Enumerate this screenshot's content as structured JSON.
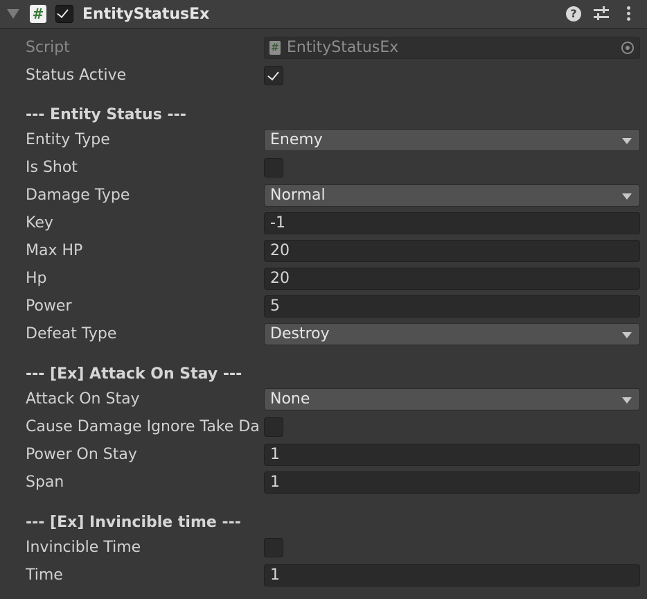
{
  "component": {
    "title": "EntityStatusEx",
    "enabled": true,
    "icon": "csharp-script-icon"
  },
  "header_icons": [
    "help-icon",
    "presets-icon",
    "kebab-menu-icon"
  ],
  "fields": {
    "script": {
      "label": "Script",
      "value": "EntityStatusEx"
    },
    "status_active": {
      "label": "Status Active",
      "checked": true
    },
    "section_entity_status": "--- Entity Status ---",
    "entity_type": {
      "label": "Entity Type",
      "value": "Enemy"
    },
    "is_shot": {
      "label": "Is Shot",
      "checked": false
    },
    "damage_type": {
      "label": "Damage Type",
      "value": "Normal"
    },
    "key": {
      "label": "Key",
      "value": "-1"
    },
    "max_hp": {
      "label": "Max HP",
      "value": "20"
    },
    "hp": {
      "label": "Hp",
      "value": "20"
    },
    "power": {
      "label": "Power",
      "value": "5"
    },
    "defeat_type": {
      "label": "Defeat Type",
      "value": "Destroy"
    },
    "section_attack_on_stay": "--- [Ex] Attack On Stay ---",
    "attack_on_stay": {
      "label": "Attack On Stay",
      "value": "None"
    },
    "cause_damage_ignore": {
      "label": "Cause Damage Ignore Take Da",
      "checked": false
    },
    "power_on_stay": {
      "label": "Power On Stay",
      "value": "1"
    },
    "span": {
      "label": "Span",
      "value": "1"
    },
    "section_invincible": "--- [Ex] Invincible time ---",
    "invincible_time": {
      "label": "Invincible Time",
      "checked": false
    },
    "time": {
      "label": "Time",
      "value": "1"
    }
  }
}
